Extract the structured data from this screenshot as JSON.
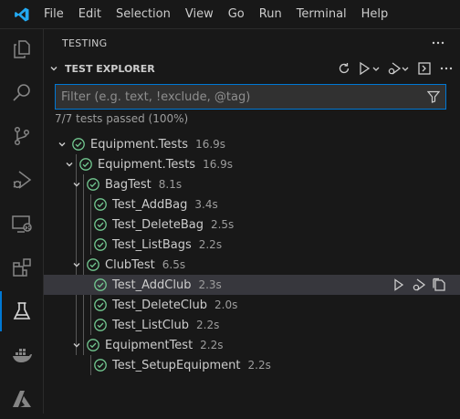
{
  "menu": [
    "File",
    "Edit",
    "Selection",
    "View",
    "Go",
    "Run",
    "Terminal",
    "Help"
  ],
  "activity_bar": [
    "explorer-icon",
    "search-icon",
    "source-control-icon",
    "run-debug-icon",
    "remote-explorer-icon",
    "extensions-icon",
    "testing-icon",
    "docker-icon",
    "azure-icon"
  ],
  "sidebar": {
    "title": "TESTING",
    "section_title": "TEST EXPLORER",
    "filter_placeholder": "Filter (e.g. text, !exclude, @tag)",
    "summary": "7/7 tests passed (100%)"
  },
  "tests": [
    {
      "name": "Equipment.Tests",
      "duration": "16.9s",
      "expanded": true
    },
    {
      "name": "Equipment.Tests",
      "duration": "16.9s",
      "expanded": true
    },
    {
      "name": "BagTest",
      "duration": "8.1s",
      "expanded": true
    },
    {
      "name": "Test_AddBag",
      "duration": "3.4s"
    },
    {
      "name": "Test_DeleteBag",
      "duration": "2.5s"
    },
    {
      "name": "Test_ListBags",
      "duration": "2.2s"
    },
    {
      "name": "ClubTest",
      "duration": "6.5s",
      "expanded": true
    },
    {
      "name": "Test_AddClub",
      "duration": "2.3s",
      "selected": true
    },
    {
      "name": "Test_DeleteClub",
      "duration": "2.0s"
    },
    {
      "name": "Test_ListClub",
      "duration": "2.2s"
    },
    {
      "name": "EquipmentTest",
      "duration": "2.2s",
      "expanded": true
    },
    {
      "name": "Test_SetupEquipment",
      "duration": "2.2s"
    }
  ],
  "colors": {
    "accent": "#0078d4",
    "pass": "#73c991",
    "background": "#181818",
    "selected_row": "#37373d"
  }
}
